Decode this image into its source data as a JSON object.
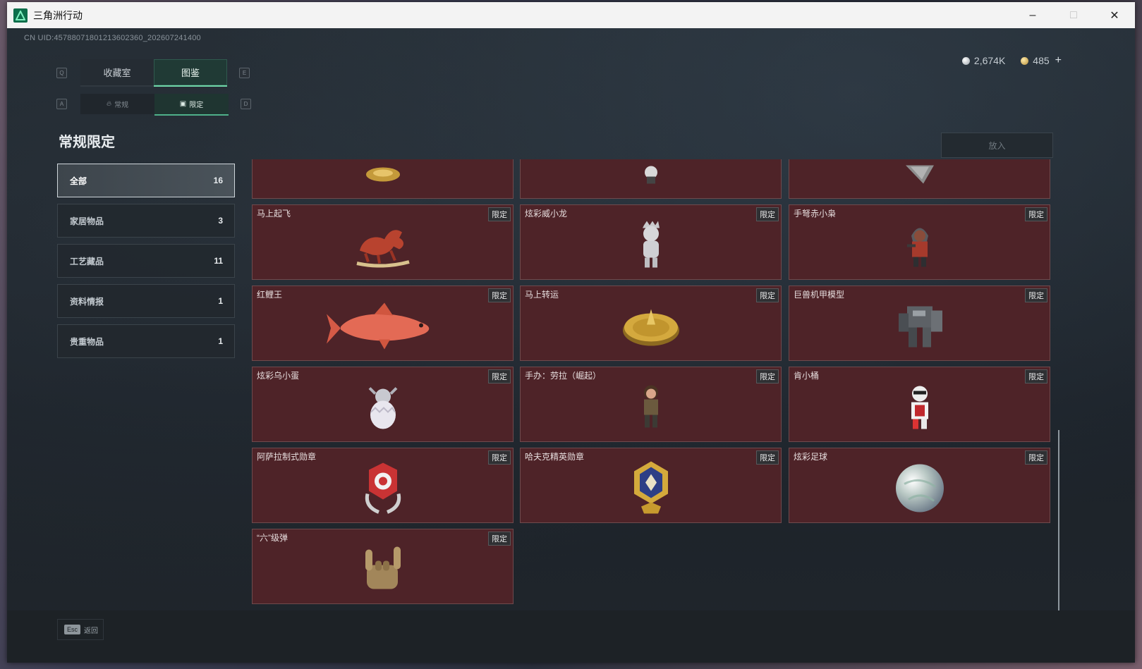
{
  "window": {
    "title": "三角洲行动",
    "minimize_icon": "minimize-icon",
    "maximize_icon": "maximize-icon",
    "close_icon": "close-icon"
  },
  "uid_text": "CN UID:457880718012136023​60_202607241400",
  "currency": {
    "silver_value": "2,674K",
    "gold_value": "485",
    "add_label": "+"
  },
  "keys": {
    "prev_main": "Q",
    "next_main": "E",
    "prev_sub": "A",
    "next_sub": "D"
  },
  "main_tabs": [
    {
      "label": "收藏室",
      "active": false
    },
    {
      "label": "图鉴",
      "active": true
    }
  ],
  "sub_tabs": [
    {
      "label": "常规",
      "icon": "flame-icon",
      "active": false
    },
    {
      "label": "限定",
      "icon": "photo-icon",
      "active": true
    }
  ],
  "page_title": "常规限定",
  "place_button": "放入",
  "categories": [
    {
      "label": "全部",
      "count": "16",
      "active": true
    },
    {
      "label": "家居物品",
      "count": "3",
      "active": false
    },
    {
      "label": "工艺藏品",
      "count": "11",
      "active": false
    },
    {
      "label": "资料情报",
      "count": "1",
      "active": false
    },
    {
      "label": "贵重物品",
      "count": "1",
      "active": false
    }
  ],
  "limited_tag": "限定",
  "items": [
    {
      "name": "",
      "tag": "",
      "art": "gold-dragon-icon"
    },
    {
      "name": "",
      "tag": "",
      "art": "figure-icon"
    },
    {
      "name": "",
      "tag": "",
      "art": "blade-icon"
    },
    {
      "name": "马上起飞",
      "tag": "限定",
      "art": "red-horse-icon"
    },
    {
      "name": "炫彩威小龙",
      "tag": "限定",
      "art": "silver-figure-icon"
    },
    {
      "name": "手弩赤小枭",
      "tag": "限定",
      "art": "hooded-figure-icon"
    },
    {
      "name": "红鲤王",
      "tag": "限定",
      "art": "koi-fish-icon"
    },
    {
      "name": "马上转运",
      "tag": "限定",
      "art": "gold-disc-icon"
    },
    {
      "name": "巨兽机甲模型",
      "tag": "限定",
      "art": "mech-icon"
    },
    {
      "name": "炫彩乌小蛋",
      "tag": "限定",
      "art": "egg-figure-icon"
    },
    {
      "name": "手办：劳拉（崛起）",
      "tag": "限定",
      "art": "lara-figure-icon"
    },
    {
      "name": "肯小桶",
      "tag": "限定",
      "art": "bucket-figure-icon"
    },
    {
      "name": "阿萨拉制式勋章",
      "tag": "限定",
      "art": "asala-medal-icon"
    },
    {
      "name": "哈夫克精英勋章",
      "tag": "限定",
      "art": "haavk-medal-icon"
    },
    {
      "name": "炫彩足球",
      "tag": "限定",
      "art": "football-icon"
    },
    {
      "name": "“六”级弹",
      "tag": "限定",
      "art": "hand-sign-icon"
    }
  ],
  "footer": {
    "esc_key": "Esc",
    "back_label": "返回"
  }
}
